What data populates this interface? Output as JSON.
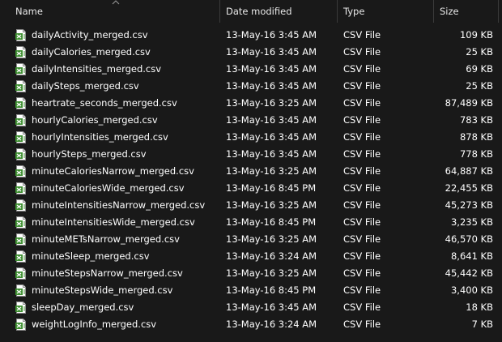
{
  "header": {
    "name_label": "Name",
    "date_label": "Date modified",
    "type_label": "Type",
    "size_label": "Size",
    "sort_icon": "chevron-up-icon"
  },
  "file_icon": "csv-file-icon",
  "files": [
    {
      "name": "dailyActivity_merged.csv",
      "date": "13-May-16 3:45 AM",
      "type": "CSV File",
      "size": "109 KB"
    },
    {
      "name": "dailyCalories_merged.csv",
      "date": "13-May-16 3:45 AM",
      "type": "CSV File",
      "size": "25 KB"
    },
    {
      "name": "dailyIntensities_merged.csv",
      "date": "13-May-16 3:45 AM",
      "type": "CSV File",
      "size": "69 KB"
    },
    {
      "name": "dailySteps_merged.csv",
      "date": "13-May-16 3:45 AM",
      "type": "CSV File",
      "size": "25 KB"
    },
    {
      "name": "heartrate_seconds_merged.csv",
      "date": "13-May-16 3:25 AM",
      "type": "CSV File",
      "size": "87,489 KB"
    },
    {
      "name": "hourlyCalories_merged.csv",
      "date": "13-May-16 3:45 AM",
      "type": "CSV File",
      "size": "783 KB"
    },
    {
      "name": "hourlyIntensities_merged.csv",
      "date": "13-May-16 3:45 AM",
      "type": "CSV File",
      "size": "878 KB"
    },
    {
      "name": "hourlySteps_merged.csv",
      "date": "13-May-16 3:45 AM",
      "type": "CSV File",
      "size": "778 KB"
    },
    {
      "name": "minuteCaloriesNarrow_merged.csv",
      "date": "13-May-16 3:25 AM",
      "type": "CSV File",
      "size": "64,887 KB"
    },
    {
      "name": "minuteCaloriesWide_merged.csv",
      "date": "13-May-16 8:45 PM",
      "type": "CSV File",
      "size": "22,455 KB"
    },
    {
      "name": "minuteIntensitiesNarrow_merged.csv",
      "date": "13-May-16 3:25 AM",
      "type": "CSV File",
      "size": "45,273 KB"
    },
    {
      "name": "minuteIntensitiesWide_merged.csv",
      "date": "13-May-16 8:45 PM",
      "type": "CSV File",
      "size": "3,235 KB"
    },
    {
      "name": "minuteMETsNarrow_merged.csv",
      "date": "13-May-16 3:25 AM",
      "type": "CSV File",
      "size": "46,570 KB"
    },
    {
      "name": "minuteSleep_merged.csv",
      "date": "13-May-16 3:24 AM",
      "type": "CSV File",
      "size": "8,641 KB"
    },
    {
      "name": "minuteStepsNarrow_merged.csv",
      "date": "13-May-16 3:25 AM",
      "type": "CSV File",
      "size": "45,442 KB"
    },
    {
      "name": "minuteStepsWide_merged.csv",
      "date": "13-May-16 8:45 PM",
      "type": "CSV File",
      "size": "3,400 KB"
    },
    {
      "name": "sleepDay_merged.csv",
      "date": "13-May-16 3:45 AM",
      "type": "CSV File",
      "size": "18 KB"
    },
    {
      "name": "weightLogInfo_merged.csv",
      "date": "13-May-16 3:24 AM",
      "type": "CSV File",
      "size": "7 KB"
    }
  ]
}
